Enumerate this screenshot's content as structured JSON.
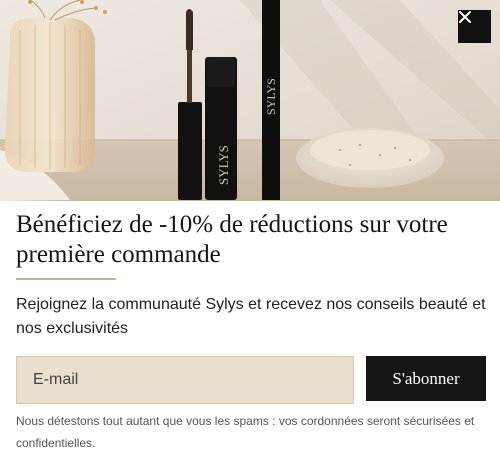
{
  "popup": {
    "brand_on_product": "SYLYS",
    "brand_on_pencil": "SYLYS",
    "title": "Bénéficiez de -10% de réductions sur votre première commande",
    "subtitle": "Rejoignez la communauté Sylys et recevez nos conseils beauté et nos exclusivités",
    "email_placeholder": "E-mail",
    "email_value": "",
    "subscribe_label": "S'abonner",
    "disclaimer": "Nous détestons tout autant que vous les spams : vos cordonnées seront sécurisées et confidentielles.",
    "close_icon": "close-icon"
  },
  "colors": {
    "accent_rule": "#c9b48e",
    "input_bg": "#eadfce",
    "button_bg": "#161616",
    "close_bg": "#111111"
  }
}
